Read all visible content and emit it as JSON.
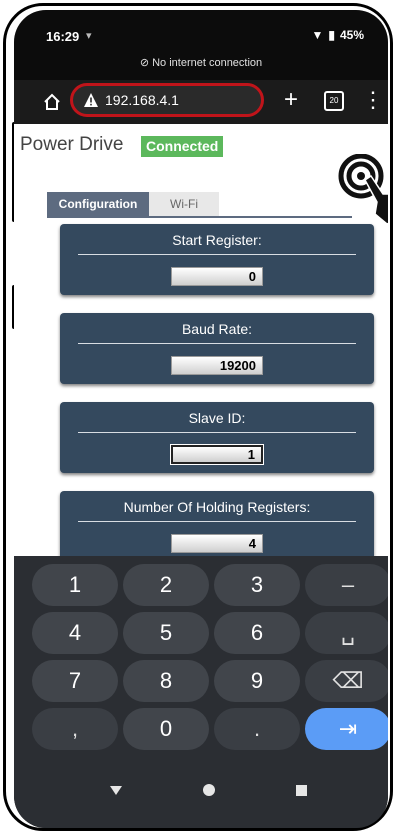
{
  "status_bar": {
    "time": "16:29",
    "battery": "45%"
  },
  "offline_notice": "No internet connection",
  "browser": {
    "url": "192.168.4.1",
    "tab_count": "20"
  },
  "page": {
    "title": "Power Drive",
    "status": "Connected",
    "status_color": "#5cb85c",
    "tabs": [
      {
        "label": "Configuration"
      },
      {
        "label": "Wi-Fi"
      }
    ],
    "fields": [
      {
        "label": "Start Register:",
        "value": "0"
      },
      {
        "label": "Baud Rate:",
        "value": "19200"
      },
      {
        "label": "Slave ID:",
        "value": "1"
      },
      {
        "label": "Number Of Holding Registers:",
        "value": "4"
      }
    ]
  },
  "keyboard": {
    "keys": [
      "1",
      "2",
      "3",
      "–",
      "4",
      "5",
      "6",
      "␣",
      "7",
      "8",
      "9",
      "⌫",
      ",",
      "0",
      ".",
      "⇥"
    ]
  },
  "colors": {
    "card_bg": "#34495e",
    "enter_key": "#5b9cf6",
    "url_highlight": "#c0141a"
  }
}
